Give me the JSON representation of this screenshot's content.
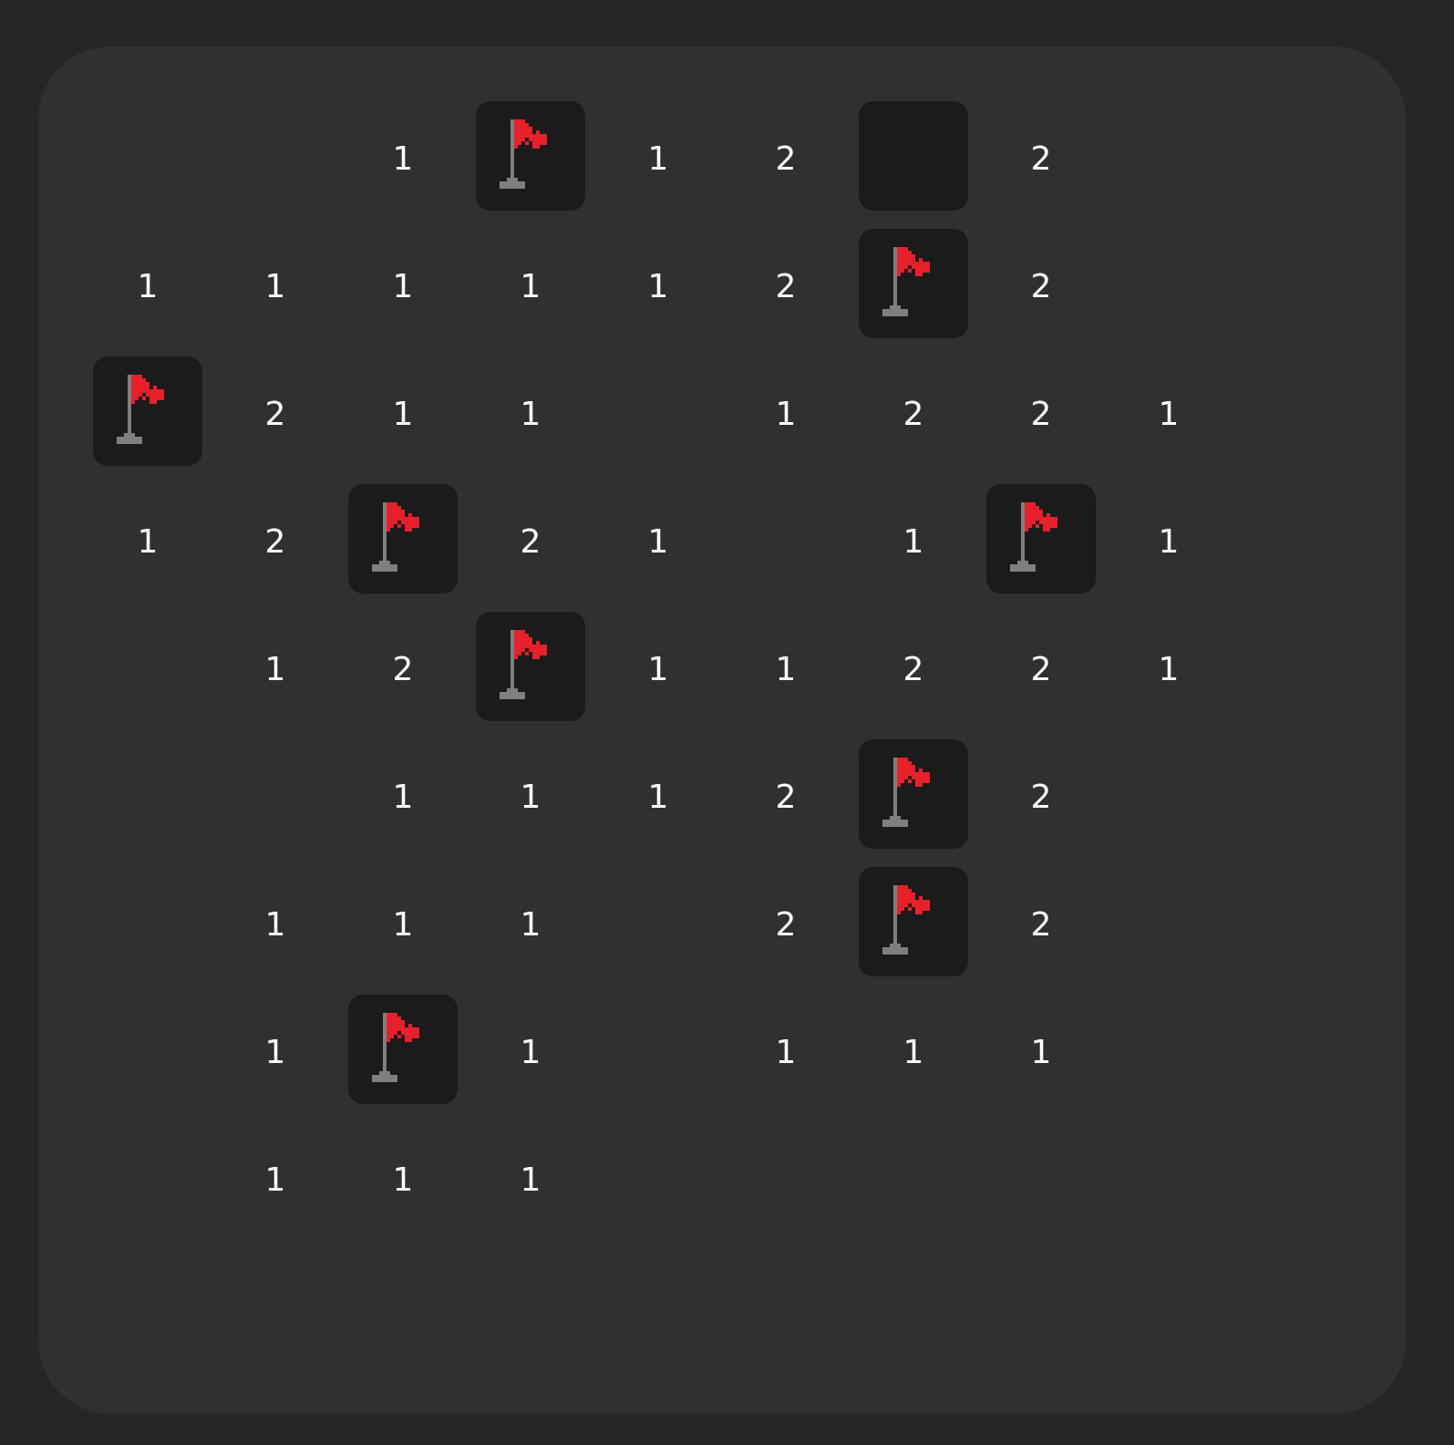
{
  "board": {
    "rows": 10,
    "cols": 10,
    "cells": [
      [
        "",
        "",
        "1",
        "F",
        "1",
        "2",
        "H",
        "2",
        "",
        ""
      ],
      [
        "1",
        "1",
        "1",
        "1",
        "1",
        "2",
        "F",
        "2",
        "",
        ""
      ],
      [
        "F",
        "2",
        "1",
        "1",
        "",
        "1",
        "2",
        "2",
        "1",
        ""
      ],
      [
        "1",
        "2",
        "F",
        "2",
        "1",
        "",
        "1",
        "F",
        "1",
        ""
      ],
      [
        "",
        "1",
        "2",
        "F",
        "1",
        "1",
        "2",
        "2",
        "1",
        ""
      ],
      [
        "",
        "",
        "1",
        "1",
        "1",
        "2",
        "F",
        "2",
        "",
        ""
      ],
      [
        "",
        "1",
        "1",
        "1",
        "",
        "2",
        "F",
        "2",
        "",
        ""
      ],
      [
        "",
        "1",
        "F",
        "1",
        "",
        "1",
        "1",
        "1",
        "",
        ""
      ],
      [
        "",
        "1",
        "1",
        "1",
        "",
        "",
        "",
        "",
        "",
        ""
      ],
      [
        "",
        "",
        "",
        "",
        "",
        "",
        "",
        "",
        "",
        ""
      ]
    ]
  },
  "colors": {
    "page_background": "#262626",
    "board_background": "#303030",
    "hidden_cell": "#1b1b1b",
    "number_text": "#ffffff",
    "flag_red": "#e8202a",
    "pole_gray": "#7f7f7f"
  },
  "icons": {
    "flag": "flag-icon"
  }
}
